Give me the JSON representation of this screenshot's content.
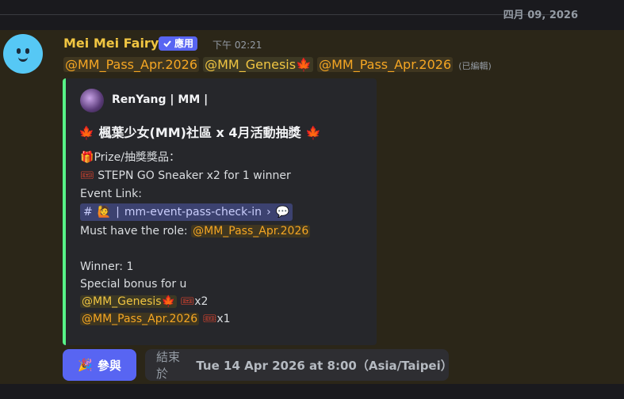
{
  "date_divider": "四月 09, 2026",
  "message": {
    "author": "Mei Mei Fairy",
    "app_badge": "應用",
    "timestamp": "下午 02:21",
    "mentions": [
      "@MM_Pass_Apr.2026",
      "@MM_Genesis",
      "@MM_Pass_Apr.2026"
    ],
    "edited": "(已編輯)"
  },
  "embed": {
    "author": "RenYang | MM |",
    "title": "楓葉少女(MM)社區 x 4月活動抽獎",
    "prize_label": "Prize/抽獎獎品：",
    "prize_item": "STEPN GO Sneaker x2 for 1 winner",
    "event_link_label": "Event Link:",
    "channel_name": "mm-event-pass-check-in",
    "role_label": "Must have the role:",
    "role_mention": "@MM_Pass_Apr.2026",
    "winner": "Winner: 1",
    "bonus_label": "Special bonus for u",
    "bonus_1_role": "@MM_Genesis",
    "bonus_1_qty": "x2",
    "bonus_2_role": "@MM_Pass_Apr.2026",
    "bonus_2_qty": "x1"
  },
  "buttons": {
    "join_label": "參與",
    "end_prefix": "結束於",
    "end_time": "Tue 14 Apr 2026 at 8:00（Asia/Taipei）"
  },
  "colors": {
    "accent": "#5865f2",
    "embed_border": "#57f287",
    "author": "#f0c542",
    "role": "#f5a623"
  }
}
